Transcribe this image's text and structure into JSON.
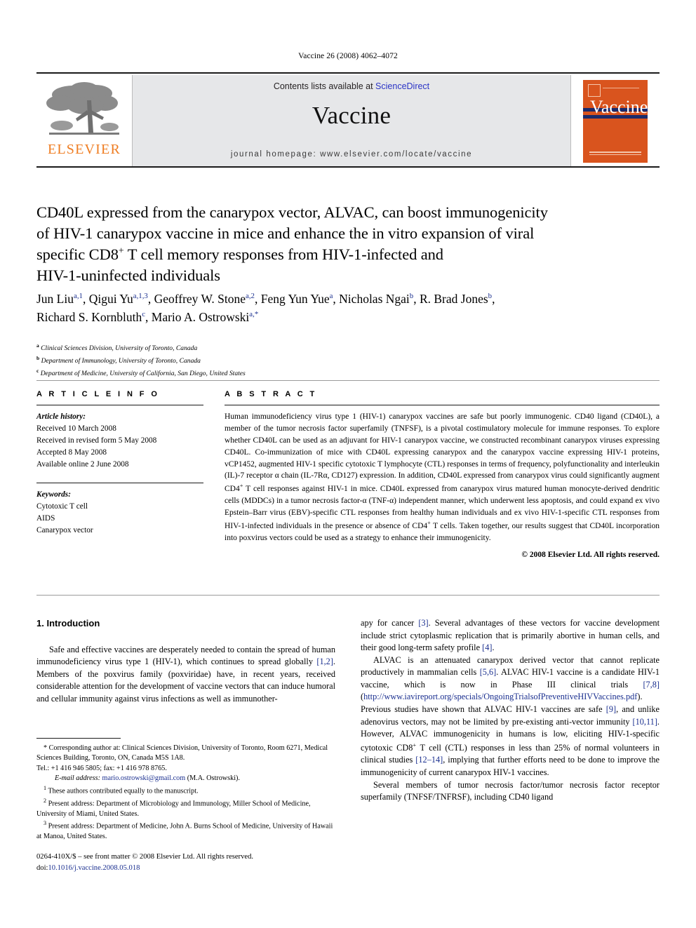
{
  "running_head": "Vaccine 26 (2008) 4062–4072",
  "banner": {
    "publisher_name": "ELSEVIER",
    "contents_prefix": "Contents lists available at ",
    "sciencedirect": "ScienceDirect",
    "journal_name": "Vaccine",
    "homepage": "journal homepage: www.elsevier.com/locate/vaccine",
    "cover_title": "Vaccine"
  },
  "article": {
    "title_line1": "CD40L expressed from the canarypox vector, ALVAC, can boost immunogenicity",
    "title_line2": "of HIV-1 canarypox vaccine in mice and enhance the in vitro expansion of viral",
    "title_line3_a": "specific CD8",
    "title_line3_sup": "+",
    "title_line3_b": " T cell memory responses from HIV-1-infected and",
    "title_line4": "HIV-1-uninfected individuals"
  },
  "authors": {
    "line1": "Jun Liu",
    "sup1": "a,1",
    "a2": ", Qigui Yu",
    "sup2": "a,1,3",
    "a3": ", Geoffrey W. Stone",
    "sup3": "a,2",
    "a4": ", Feng Yun Yue",
    "sup4": "a",
    "a5": ", Nicholas Ngai",
    "sup5": "b",
    "a6": ", R. Brad Jones",
    "sup6": "b",
    "a7": ",",
    "line2_a": "Richard S. Kornbluth",
    "sup7": "c",
    "line2_b": ", Mario A. Ostrowski",
    "sup8": "a,*"
  },
  "affiliations": [
    {
      "mark": "a",
      "text": "Clinical Sciences Division, University of Toronto, Canada"
    },
    {
      "mark": "b",
      "text": "Department of Immunology, University of Toronto, Canada"
    },
    {
      "mark": "c",
      "text": "Department of Medicine, University of California, San Diego, United States"
    }
  ],
  "article_info": {
    "heading": "A R T I C L E   I N F O",
    "history_label": "Article history:",
    "history": [
      "Received 10 March 2008",
      "Received in revised form 5 May 2008",
      "Accepted 8 May 2008",
      "Available online 2 June 2008"
    ],
    "keywords_label": "Keywords:",
    "keywords": [
      "Cytotoxic T cell",
      "AIDS",
      "Canarypox vector"
    ]
  },
  "abstract": {
    "heading": "A B S T R A C T",
    "part1": "Human immunodeficiency virus type 1 (HIV-1) canarypox vaccines are safe but poorly immunogenic. CD40 ligand (CD40L), a member of the tumor necrosis factor superfamily (TNFSF), is a pivotal costimulatory molecule for immune responses. To explore whether CD40L can be used as an adjuvant for HIV-1 canarypox vaccine, we constructed recombinant canarypox viruses expressing CD40L. Co-immunization of mice with CD40L expressing canarypox and the canarypox vaccine expressing HIV-1 proteins, vCP1452, augmented HIV-1 specific cytotoxic T lymphocyte (CTL) responses in terms of frequency, polyfunctionality and interleukin (IL)-7 receptor α chain (IL-7Rα, CD127) expression. In addition, CD40L expressed from canarypox virus could significantly augment CD4",
    "sup1": "+",
    "part2": " T cell responses against HIV-1 in mice. CD40L expressed from canarypox virus matured human monocyte-derived dendritic cells (MDDCs) in a tumor necrosis factor-α (TNF-α) independent manner, which underwent less apoptosis, and could expand ex vivo Epstein–Barr virus (EBV)-specific CTL responses from healthy human individuals and ex vivo HIV-1-specific CTL responses from HIV-1-infected individuals in the presence or absence of CD4",
    "sup2": "+",
    "part3": " T cells. Taken together, our results suggest that CD40L incorporation into poxvirus vectors could be used as a strategy to enhance their immunogenicity.",
    "copyright": "© 2008 Elsevier Ltd. All rights reserved."
  },
  "introduction": {
    "heading": "1.  Introduction",
    "left_p1_a": "Safe and effective vaccines are desperately needed to contain the spread of human immunodeficiency virus type 1 (HIV-1), which continues to spread globally ",
    "left_ref1": "[1,2]",
    "left_p1_b": ". Members of the poxvirus family (poxviridae) have, in recent years, received considerable attention for the development of vaccine vectors that can induce humoral and cellular immunity against virus infections as well as immunother-",
    "right_p1_a": "apy for cancer ",
    "right_ref1": "[3]",
    "right_p1_b": ". Several advantages of these vectors for vaccine development include strict cytoplasmic replication that is primarily abortive in human cells, and their good long-term safety profile ",
    "right_ref2": "[4]",
    "right_p1_c": ".",
    "right_p2_a": "ALVAC is an attenuated canarypox derived vector that cannot replicate productively in mammalian cells ",
    "right_ref3": "[5,6]",
    "right_p2_b": ". ALVAC HIV-1 vaccine is a candidate HIV-1 vaccine, which is now in Phase III clinical trials ",
    "right_ref4": "[7,8]",
    "right_p2_c": " (",
    "right_url": "http://www.iavireport.org/specials/OngoingTrialsofPreventiveHIVVaccines.pdf",
    "right_p2_d": "). Previous studies have shown that ALVAC HIV-1 vaccines are safe ",
    "right_ref5": "[9]",
    "right_p2_e": ", and unlike adenovirus vectors, may not be limited by pre-existing anti-vector immunity ",
    "right_ref6": "[10,11]",
    "right_p2_f": ". However, ALVAC immunogenicity in humans is low, eliciting HIV-1-specific cytotoxic CD8",
    "right_sup1": "+",
    "right_p2_g": " T cell (CTL) responses in less than 25% of normal volunteers in clinical studies ",
    "right_ref7": "[12–14]",
    "right_p2_h": ", implying that further efforts need to be done to improve the immunogenicity of current canarypox HIV-1 vaccines.",
    "right_p3": "Several members of tumor necrosis factor/tumor necrosis factor receptor superfamily (TNFSF/TNFRSF), including CD40 ligand"
  },
  "footnotes": {
    "corresponding_mark": "*",
    "corresponding": " Corresponding author at: Clinical Sciences Division, University of Toronto, Room 6271, Medical Sciences Building, Toronto, ON, Canada M5S 1A8.",
    "tel": "Tel.: +1 416 946 5805; fax: +1 416 978 8765.",
    "email_label": "E-mail address:",
    "email": "mario.ostrowski@gmail.com",
    "email_suffix": " (M.A. Ostrowski).",
    "fn1_mark": "1",
    "fn1": " These authors contributed equally to the manuscript.",
    "fn2_mark": "2",
    "fn2": " Present address: Department of Microbiology and Immunology, Miller School of Medicine, University of Miami, United States.",
    "fn3_mark": "3",
    "fn3": " Present address: Department of Medicine, John A. Burns School of Medicine, University of Hawaii at Manoa, United States."
  },
  "bottom": {
    "issn_line": "0264-410X/$ – see front matter © 2008 Elsevier Ltd. All rights reserved.",
    "doi_label": "doi:",
    "doi": "10.1016/j.vaccine.2008.05.018"
  },
  "colors": {
    "elsevier_orange": "#ef7d22",
    "link_blue": "#1a2f8f",
    "sciencedirect_blue": "#2b34c6",
    "banner_gray": "#e6e7e9",
    "cover_orange": "#d9541e"
  }
}
